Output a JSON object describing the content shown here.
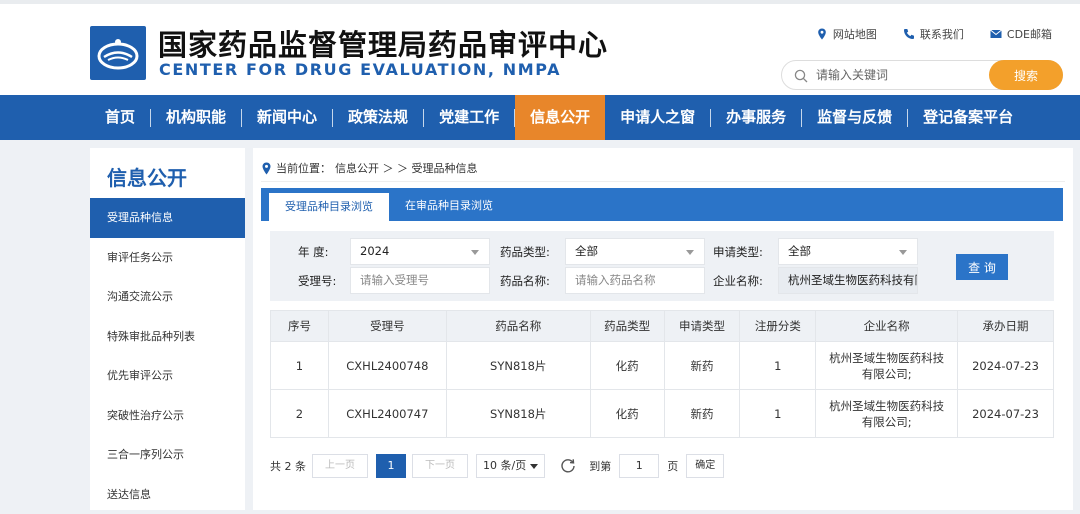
{
  "header": {
    "title_cn": "国家药品监督管理局药品审评中心",
    "title_en": "CENTER FOR DRUG EVALUATION, NMPA",
    "links": [
      {
        "label": "网站地图",
        "icon": "location-pin-icon"
      },
      {
        "label": "联系我们",
        "icon": "phone-icon"
      },
      {
        "label": "CDE邮箱",
        "icon": "mail-icon"
      }
    ],
    "search_placeholder": "请输入关键词",
    "search_button": "搜索"
  },
  "nav": {
    "items": [
      "首页",
      "机构职能",
      "新闻中心",
      "政策法规",
      "党建工作",
      "信息公开",
      "申请人之窗",
      "办事服务",
      "监督与反馈",
      "登记备案平台"
    ],
    "active_index": 5
  },
  "sidebar": {
    "title": "信息公开",
    "items": [
      "受理品种信息",
      "审评任务公示",
      "沟通交流公示",
      "特殊审批品种列表",
      "优先审评公示",
      "突破性治疗公示",
      "三合一序列公示",
      "送达信息"
    ],
    "active_index": 0
  },
  "breadcrumb": {
    "prefix": "当前位置：",
    "path": "信息公开 ＞ ＞ 受理品种信息"
  },
  "tabs": [
    "受理品种目录浏览",
    "在审品种目录浏览"
  ],
  "filter": {
    "year_label": "年  度:",
    "year_value": "2024",
    "drug_type_label": "药品类型:",
    "drug_type_value": "全部",
    "apply_type_label": "申请类型:",
    "apply_type_value": "全部",
    "accept_no_label": "受理号:",
    "accept_no_placeholder": "请输入受理号",
    "drug_name_label": "药品名称:",
    "drug_name_placeholder": "请输入药品名称",
    "company_label": "企业名称:",
    "company_value": "杭州圣域生物医药科技有限",
    "query_button": "查 询"
  },
  "table": {
    "headers": [
      "序号",
      "受理号",
      "药品名称",
      "药品类型",
      "申请类型",
      "注册分类",
      "企业名称",
      "承办日期"
    ],
    "rows": [
      [
        "1",
        "CXHL2400748",
        "SYN818片",
        "化药",
        "新药",
        "1",
        "杭州圣域生物医药科技有限公司;",
        "2024-07-23"
      ],
      [
        "2",
        "CXHL2400747",
        "SYN818片",
        "化药",
        "新药",
        "1",
        "杭州圣域生物医药科技有限公司;",
        "2024-07-23"
      ]
    ]
  },
  "pager": {
    "total": "共 2 条",
    "prev": "上一页",
    "current": "1",
    "next": "下一页",
    "page_size": "10 条/页",
    "goto_label": "到第",
    "goto_value": "1",
    "page_unit": "页",
    "confirm": "确定"
  },
  "colors": {
    "primary": "#1f5fae",
    "accent": "#e8862a",
    "search_button": "#f3a02b"
  }
}
